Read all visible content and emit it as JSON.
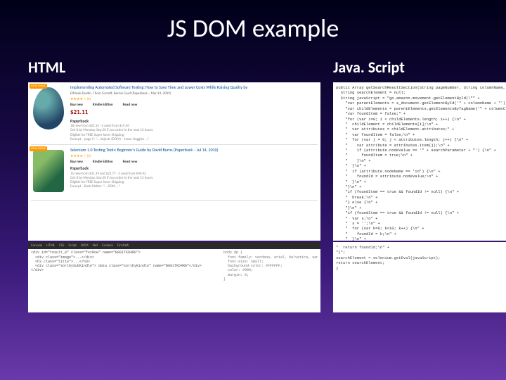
{
  "title": "JS DOM example",
  "left": {
    "heading": "HTML",
    "products": [
      {
        "look": "LOOK INSIDE",
        "title": "Implementing Automated Software Testing: How to Save Time and Lower Costs While Raising Quality by",
        "author": "Elfriede Dustin, Thom Garrett, Bernie Gauf (Paperback – Mar 14, 2009)",
        "stars": "★★★★☆ (6)",
        "opt_buy_h": "Buy new",
        "opt_k_h": "Kindle Edition",
        "opt_r_h": "Read now",
        "price": "$21.11",
        "pb": "Paperback",
        "offers": "18 new from $22.15 · 5 used from $19.46",
        "ship": "Get it by Monday, Sep 20 if you order in the next 13 hours.",
        "elig": "Eligible for FREE Super Saver Shipping.",
        "excerpt": "Excerpt – page 5: \"… objects (DOM) – Jason Huggins …\""
      },
      {
        "look": "LOOK INSIDE",
        "title": "Selenium 1.0 Testing Tools: Beginner's Guide by David Burns (Paperback – Jul 14, 2010)",
        "author": "",
        "stars": "★★★★☆ (3)",
        "opt_buy_h": "Buy new",
        "opt_k_h": "Kindle Edition",
        "opt_r_h": "Read now",
        "price": "",
        "pb": "Paperback",
        "offers": "15 new from $31.39 and $21.77 · 3 used from $40.42",
        "ship": "Get it by Monday, Sep 20 if you order in the next 13 hours.",
        "elig": "Eligible for FREE Super Saver Shipping.",
        "excerpt": "Excerpt – Back Matter: \"… DOM …\""
      }
    ],
    "devtabs": [
      "Console",
      "HTML",
      "CSS",
      "Script",
      "DOM",
      "Net",
      "Cookies",
      "FirePath"
    ],
    "htmlsrc_left": "<div id=\"result_0\" class=\"fstRow\" name=\"B001TKD4RG\">\n  <div class=\"image\">...</div>\n  <h3 class=\"title\">...</h3>\n  <div class=\"sortbySubKindle\"> data class=\"sortbyKindle\" name=\"B001TKD4RG\"</div>\n</div>",
    "htmlsrc_right": "body.dp {\n  font-family: verdana, arial, helvetica, sans-serif;\n  font-size: small;\n  background-color: #FFFFFF;\n  color: #000;\n  margin: 0;\n}"
  },
  "right": {
    "heading": "Java. Script",
    "code_main": "public Array getSearchResultSection(String pageNumber, String columnName, String columnClassName, String searchParameter) {\n  String searchElement = null;\n  String javaScript = \"go.amazon.movement.getElementById(\\\"\" +\n    \"var parentElements = s_document.getElementById('\" + columnName + \"');\\n\" +\n    \"var childElements = parentElements.getElementsByTagName('\" + columnClassName + \"');\\n\" +\n    \"var foundItem = false;\" +\n    \"for (var i=0; i < childElements.length; i++) {\\n\" +\n    \"  childElement = childElements[i];\\n\" +\n    \"  var attributes = childElement.attributes;\" +\n    \"  var foundItem = false;\\n\" +\n    \"  for (var j = 0; j < attributes.length; j++) {\\n\" +\n    \"    var attribute = attributes.item(j);\\n\" +\n    \"    if (attribute.nodeValue == '\" + searchParameter + \"') {\\n\" +\n    \"      foundItem = true;\\n\" +\n    \"    }\\n\" +\n    \"  }\\n\" +\n    \"  if (attribute.nodeName == 'id') {\\n\" +\n    \"    foundId = attribute.nodeValue;\\n\" +\n    \"  }\\n\" +\n    \"}\\n\" +\n    \"if (foundItem == true && foundId != null) {\\n\" +\n    \"  break;\\n\" +\n    \"} else {\\n\" +\n    \"}\\n\" +\n    \"if (foundItem == true && foundId != null) {\\n\" +\n    \"  var s;\\n\" +\n    \"  s = '';\\n\" +\n    \"  for (var k=0; k<10; k++) {\\n\" +\n    \"    foundId = k;\\n\" +\n    \"  }\\n\" +\n    \"}\\n\";",
    "code_lower": "\"  return foundId;\\n\" +\n\"}\";\nsearchElement = selenium.getEval(javaScript);\nreturn searchElement;\n}"
  }
}
